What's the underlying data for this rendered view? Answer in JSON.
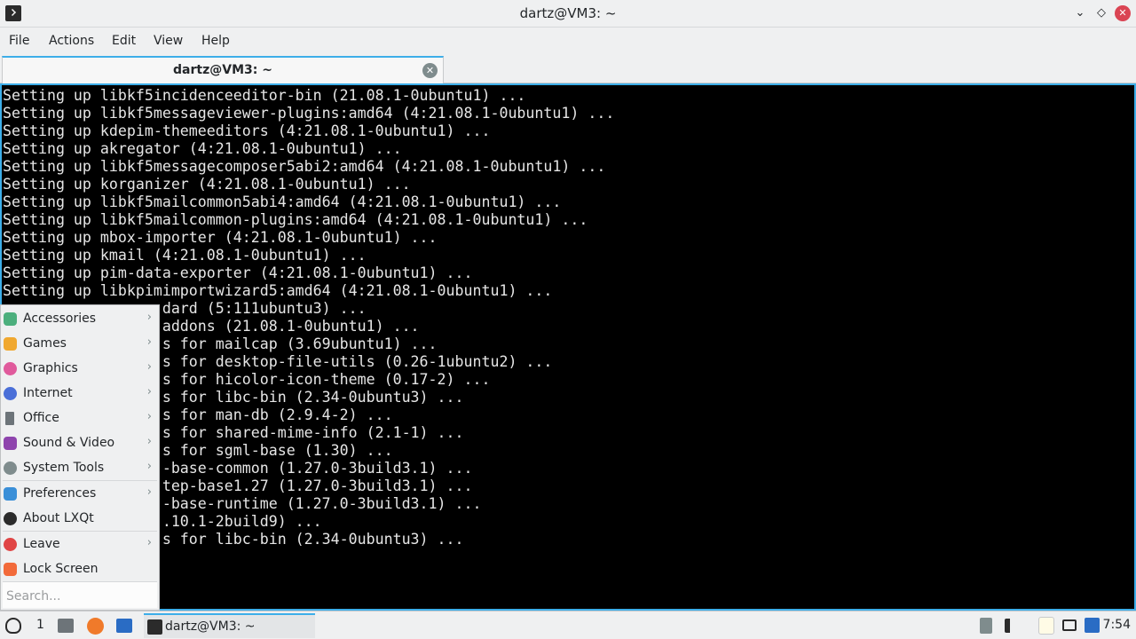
{
  "window": {
    "title": "dartz@VM3: ~",
    "minimize_glyph": "⌄",
    "maximize_glyph": "◇",
    "close_glyph": "✕"
  },
  "menubar": {
    "items": [
      "File",
      "Actions",
      "Edit",
      "View",
      "Help"
    ]
  },
  "tab": {
    "label": "dartz@VM3: ~",
    "close_glyph": "✕"
  },
  "terminal": {
    "lines": [
      "Setting up libkf5incidenceeditor-bin (21.08.1-0ubuntu1) ...",
      "Setting up libkf5messageviewer-plugins:amd64 (4:21.08.1-0ubuntu1) ...",
      "Setting up kdepim-themeeditors (4:21.08.1-0ubuntu1) ...",
      "Setting up akregator (4:21.08.1-0ubuntu1) ...",
      "Setting up libkf5messagecomposer5abi2:amd64 (4:21.08.1-0ubuntu1) ...",
      "Setting up korganizer (4:21.08.1-0ubuntu1) ...",
      "Setting up libkf5mailcommon5abi4:amd64 (4:21.08.1-0ubuntu1) ...",
      "Setting up libkf5mailcommon-plugins:amd64 (4:21.08.1-0ubuntu1) ...",
      "Setting up mbox-importer (4:21.08.1-0ubuntu1) ...",
      "Setting up kmail (4:21.08.1-0ubuntu1) ...",
      "Setting up pim-data-exporter (4:21.08.1-0ubuntu1) ...",
      "Setting up libkpimimportwizard5:amd64 (4:21.08.1-0ubuntu1) ...",
      "                  dard (5:111ubuntu3) ...",
      "                  addons (21.08.1-0ubuntu1) ...",
      "                  s for mailcap (3.69ubuntu1) ...",
      "                  s for desktop-file-utils (0.26-1ubuntu2) ...",
      "                  s for hicolor-icon-theme (0.17-2) ...",
      "                  s for libc-bin (2.34-0ubuntu3) ...",
      "                  s for man-db (2.9.4-2) ...",
      "                  s for shared-mime-info (2.1-1) ...",
      "                  s for sgml-base (1.30) ...",
      "                  -base-common (1.27.0-3build3.1) ...",
      "                  tep-base1.27 (1.27.0-3build3.1) ...",
      "                  -base-runtime (1.27.0-3build3.1) ...",
      "                  .10.1-2build9) ...",
      "                  s for libc-bin (2.34-0ubuntu3) ..."
    ]
  },
  "app_menu": {
    "arrow_glyph": "›",
    "items": [
      {
        "label": "Accessories",
        "icon": "accessories-icon",
        "color": "#4caf7d",
        "submenu": true
      },
      {
        "label": "Games",
        "icon": "games-icon",
        "color": "#f0a830",
        "submenu": true
      },
      {
        "label": "Graphics",
        "icon": "graphics-icon",
        "color": "#e05a9c",
        "submenu": true
      },
      {
        "label": "Internet",
        "icon": "internet-icon",
        "color": "#4a6fd8",
        "submenu": true
      },
      {
        "label": "Office",
        "icon": "office-icon",
        "color": "#6d7479",
        "submenu": true
      },
      {
        "label": "Sound & Video",
        "icon": "sound-video-icon",
        "color": "#8e44ad",
        "submenu": true
      },
      {
        "label": "System Tools",
        "icon": "system-tools-icon",
        "color": "#7f8c8d",
        "submenu": true
      },
      {
        "label": "Preferences",
        "icon": "preferences-icon",
        "color": "#3a8fd8",
        "submenu": true
      },
      {
        "label": "About LXQt",
        "icon": "about-icon",
        "color": "#2b2b2b",
        "submenu": false
      },
      {
        "label": "Leave",
        "icon": "leave-icon",
        "color": "#e04545",
        "submenu": true
      },
      {
        "label": "Lock Screen",
        "icon": "lock-icon",
        "color": "#f26a3a",
        "submenu": false
      }
    ],
    "search_placeholder": "Search..."
  },
  "taskbar": {
    "desktop_number": "1",
    "task_label": "dartz@VM3: ~",
    "clock": "7:54",
    "accent": "#3daee9"
  }
}
